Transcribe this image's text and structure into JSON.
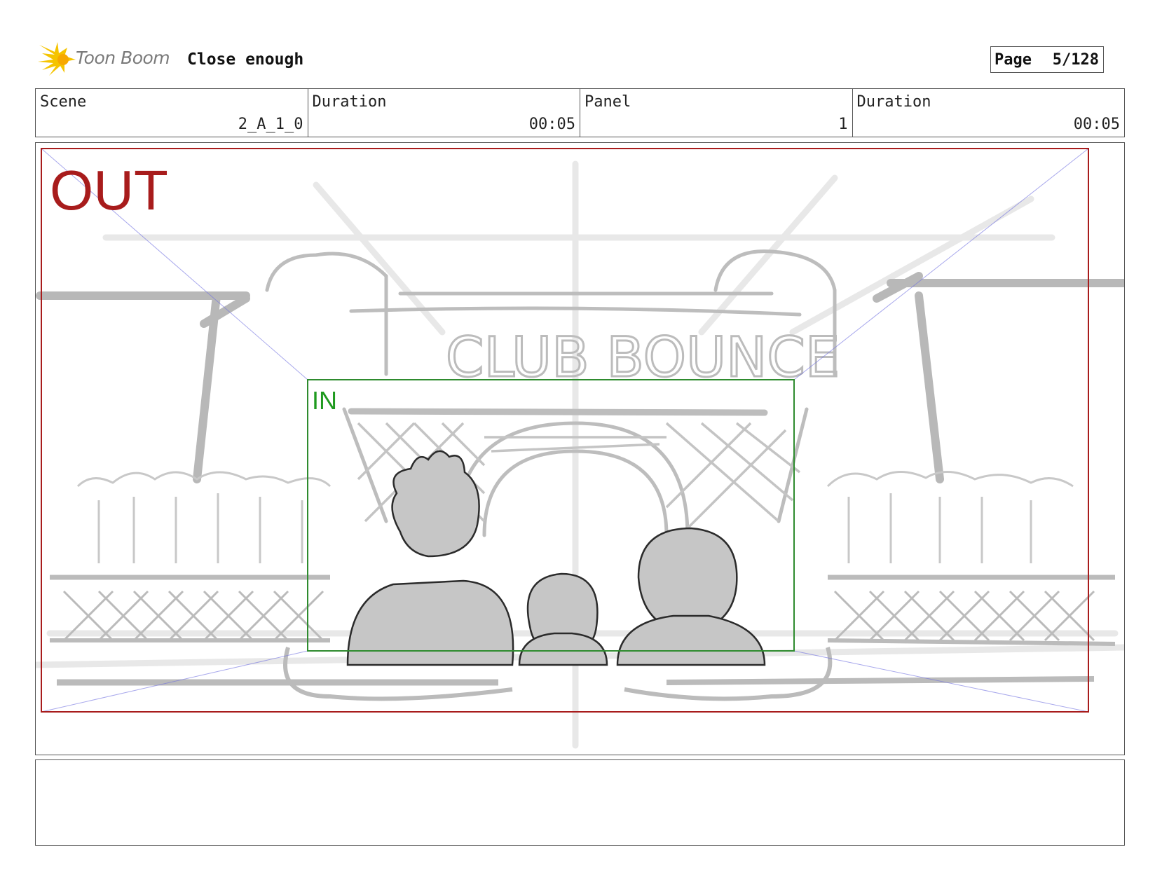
{
  "header": {
    "logo_text": "Toon Boom",
    "title": "Close enough",
    "page_label": "Page",
    "page_value": "5/128"
  },
  "info": {
    "scene_label": "Scene",
    "scene_value": "2_A_1_0",
    "duration_label": "Duration",
    "duration_value": "00:05",
    "panel_label": "Panel",
    "panel_value": "1",
    "panel_duration_label": "Duration",
    "panel_duration_value": "00:05"
  },
  "frame": {
    "out_label": "OUT",
    "in_label": "IN",
    "sign_text": "CLUB BOUNCE",
    "out_color": "#a81c1c",
    "in_color": "#2e8b2e"
  },
  "notes": {
    "text": ""
  }
}
